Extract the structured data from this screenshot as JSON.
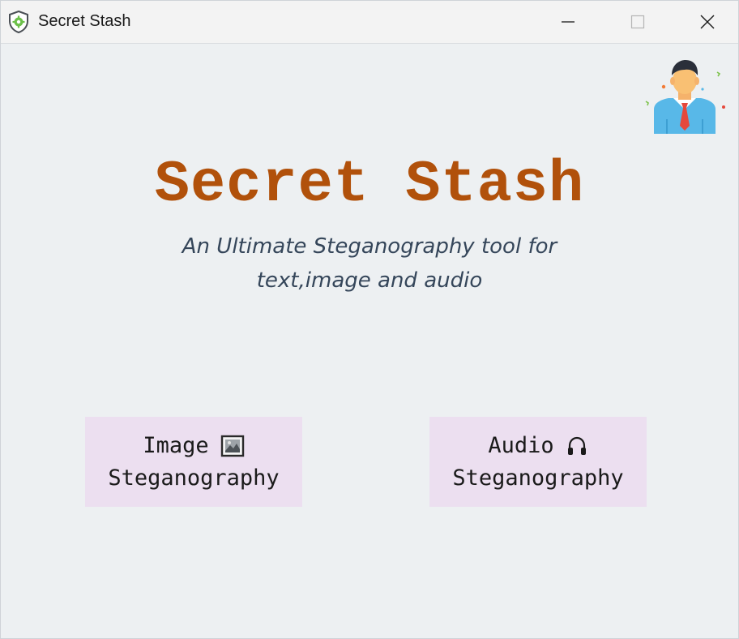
{
  "window": {
    "title": "Secret Stash",
    "app_icon": "shield-gear-icon",
    "controls": {
      "minimize": "minimize-icon",
      "maximize": "maximize-icon",
      "close": "close-icon"
    }
  },
  "header": {
    "avatar_icon": "businessman-avatar-icon",
    "title": "Secret Stash",
    "subtitle_line1": "An Ultimate Steganography tool for",
    "subtitle_line2": "text,image and audio"
  },
  "buttons": {
    "image": {
      "label_line1": "Image",
      "label_line2": "Steganography",
      "icon": "picture-icon"
    },
    "audio": {
      "label_line1": "Audio",
      "label_line2": "Steganography",
      "icon": "headphones-icon"
    }
  },
  "colors": {
    "title": "#b1510b",
    "subtitle": "#35465a",
    "background": "#edf0f2",
    "button_bg": "#ecdff0",
    "titlebar": "#f3f3f3"
  }
}
